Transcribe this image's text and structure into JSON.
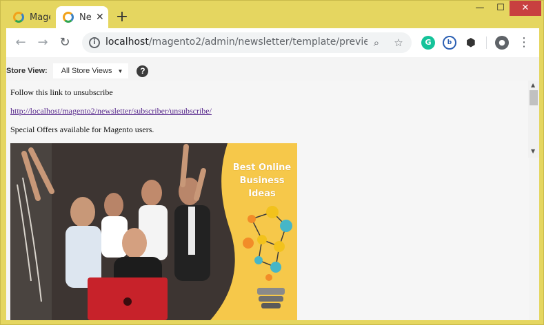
{
  "browser": {
    "tabs": [
      {
        "title": "Mage",
        "active": false
      },
      {
        "title": "Ne",
        "active": true
      }
    ],
    "new_tab_glyph": "+",
    "window_controls": {
      "minimize": "—",
      "maximize": "☐",
      "close": "✕"
    },
    "url_host": "localhost",
    "url_path": "/magento2/admin/newsletter/template/preview/i...",
    "icons": [
      "back-arrow-icon",
      "forward-arrow-icon",
      "reload-icon",
      "site-info-icon",
      "zoom-icon",
      "bookmark-star-icon",
      "grammarly-icon",
      "extension-icon",
      "cube-extension-icon",
      "profile-icon",
      "menu-icon"
    ]
  },
  "toolbar": {
    "store_view_label": "Store View:",
    "store_view_value": "All Store Views",
    "help_glyph": "?"
  },
  "preview": {
    "unsubscribe_text": "Follow this link to unsubscribe",
    "unsubscribe_link": "http://localhost/magento2/newsletter/subscriber/unsubscribe/",
    "offers_text": "Special Offers available for Magento users.",
    "banner_caption_line1": "Best Online",
    "banner_caption_line2": "Business Ideas"
  },
  "colors": {
    "window_frame": "#e5d660",
    "close_button": "#c84040",
    "link": "#5b2d8f",
    "banner_yellow": "#f6c84a"
  }
}
